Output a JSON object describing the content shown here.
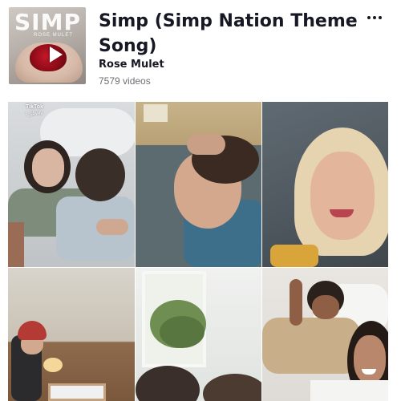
{
  "sound": {
    "title": "Simp (Simp Nation Theme Song)",
    "artist": "Rose Mulet",
    "video_count": "7579 videos",
    "cover_text": "SIMP",
    "cover_subtext": "ROSE MULET"
  },
  "videos": [
    {
      "watermark": "TikTok",
      "user": "r_gbv4v"
    },
    {},
    {},
    {},
    {},
    {}
  ],
  "icons": {
    "play": "play-icon",
    "more": "more-options-icon"
  }
}
